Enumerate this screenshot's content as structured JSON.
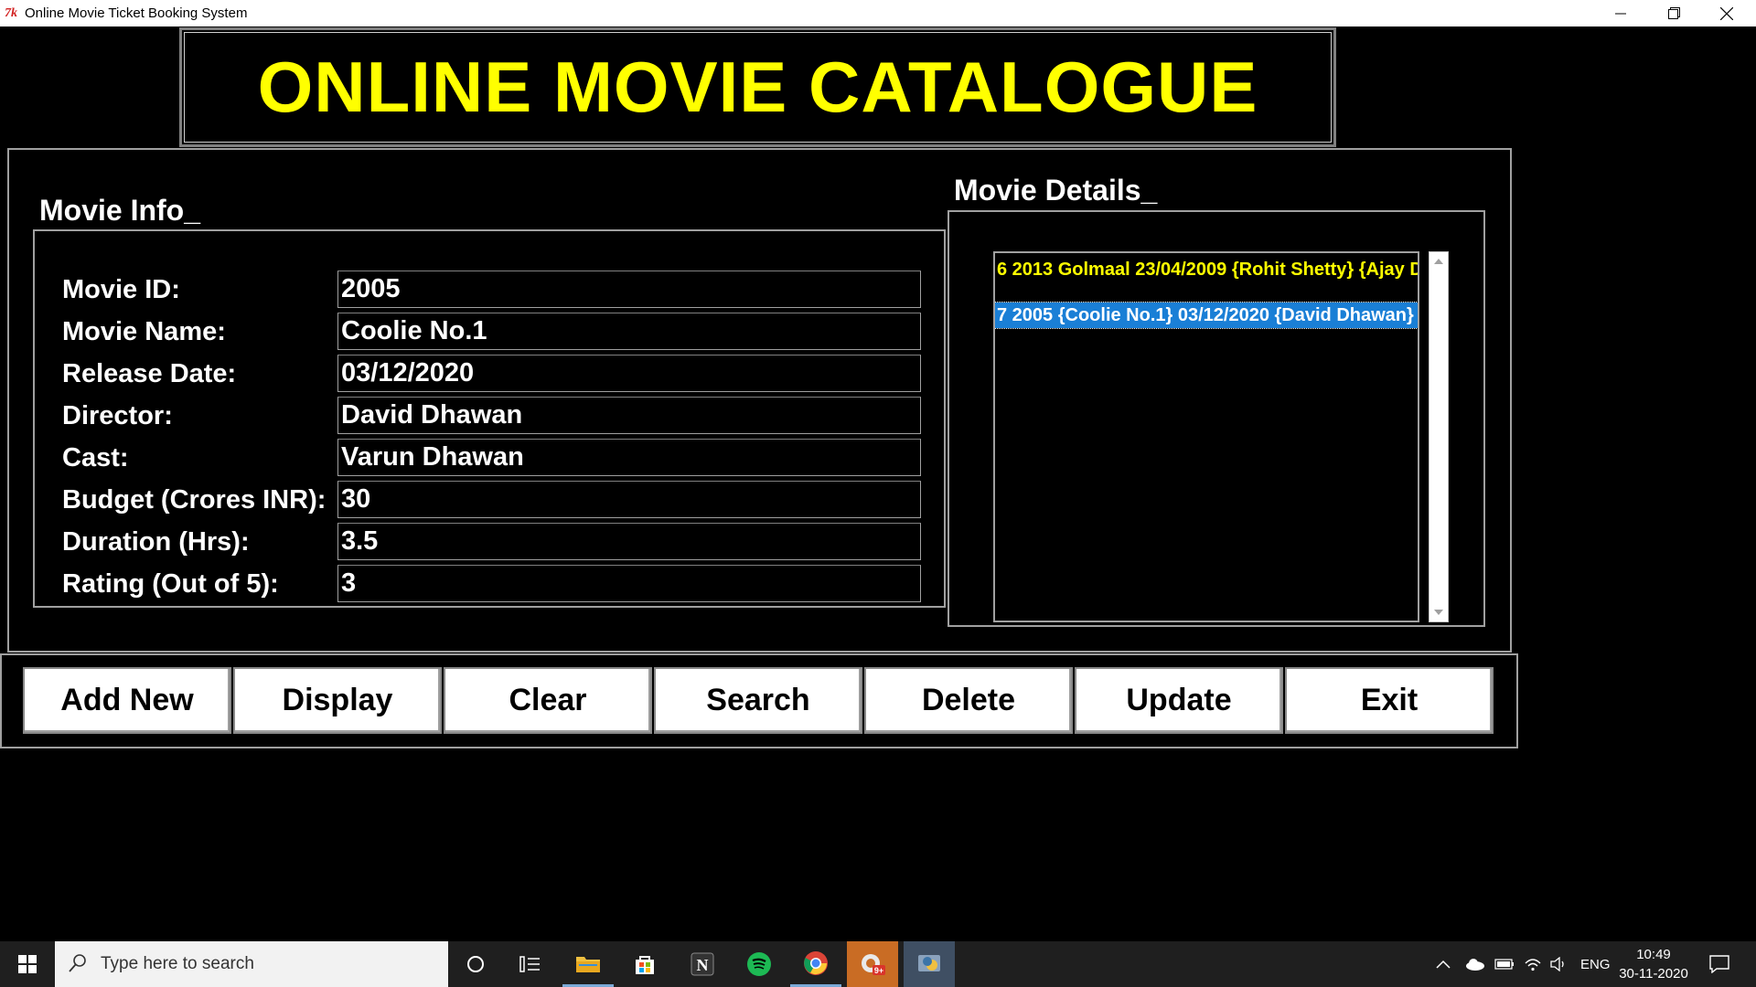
{
  "window": {
    "title": "Online Movie Ticket Booking System",
    "app_icon_text": "7k"
  },
  "banner": {
    "title": "ONLINE MOVIE CATALOGUE"
  },
  "movie_info": {
    "legend": "Movie Info_",
    "fields": [
      {
        "label": "Movie ID:",
        "value": "2005"
      },
      {
        "label": "Movie Name:",
        "value": "Coolie No.1"
      },
      {
        "label": "Release Date:",
        "value": "03/12/2020"
      },
      {
        "label": "Director:",
        "value": "David Dhawan"
      },
      {
        "label": "Cast:",
        "value": "Varun Dhawan"
      },
      {
        "label": "Budget (Crores INR):",
        "value": "30"
      },
      {
        "label": "Duration (Hrs):",
        "value": "3.5"
      },
      {
        "label": "Rating (Out of 5):",
        "value": "3"
      }
    ]
  },
  "movie_details": {
    "legend": "Movie Details_",
    "items": [
      {
        "text": "6 2013 Golmaal 23/04/2009 {Rohit Shetty} {Ajay D",
        "selected": false
      },
      {
        "text": "7 2005 {Coolie No.1} 03/12/2020 {David Dhawan}",
        "selected": true
      }
    ]
  },
  "buttons": {
    "add_new": "Add New",
    "display": "Display",
    "clear": "Clear",
    "search": "Search",
    "delete": "Delete",
    "update": "Update",
    "exit": "Exit"
  },
  "taskbar": {
    "search_placeholder": "Type here to search",
    "language": "ENG",
    "time": "10:49",
    "date": "30-11-2020",
    "badge": "9+"
  },
  "colors": {
    "banner_text": "#ffff00",
    "selection": "#1a7fd6",
    "list_text": "#ffff00",
    "background": "#000000"
  }
}
